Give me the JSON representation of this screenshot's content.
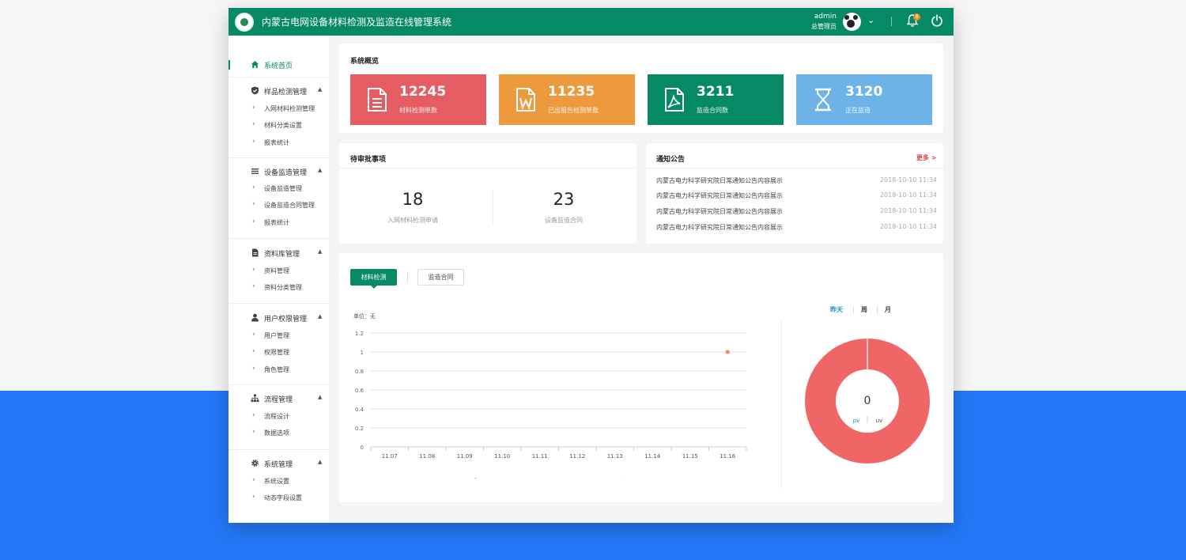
{
  "header": {
    "title": "内蒙古电网设备材料检测及监造在线管理系统",
    "user_name": "admin",
    "user_role": "总管理员",
    "notification_count": "8"
  },
  "sidebar": {
    "home": "系统首页",
    "groups": [
      {
        "label": "样品检测管理",
        "icon": "shield-check-icon",
        "items": [
          "入网材料检测管理",
          "材料分类设置",
          "报表统计"
        ]
      },
      {
        "label": "设备监造管理",
        "icon": "list-icon",
        "items": [
          "设备监造管理",
          "设备监造合同管理",
          "报表统计"
        ]
      },
      {
        "label": "资料库管理",
        "icon": "document-icon",
        "items": [
          "资料管理",
          "资料分类管理"
        ]
      },
      {
        "label": "用户权限管理",
        "icon": "user-icon",
        "items": [
          "用户管理",
          "权限管理",
          "角色管理"
        ]
      },
      {
        "label": "流程管理",
        "icon": "sitemap-icon",
        "items": [
          "流程设计",
          "数据选项"
        ]
      },
      {
        "label": "系统管理",
        "icon": "gear-icon",
        "items": [
          "系统设置",
          "动态字段设置"
        ]
      }
    ]
  },
  "overview": {
    "title": "系统概览",
    "cards": [
      {
        "value": "12245",
        "label": "材料检测单数",
        "color": "#e55c63",
        "icon": "document-lines-icon"
      },
      {
        "value": "11235",
        "label": "已出报告检测单数",
        "color": "#ec9a3d",
        "icon": "word-doc-icon"
      },
      {
        "value": "3211",
        "label": "监造合同数",
        "color": "#068a66",
        "icon": "pdf-doc-icon"
      },
      {
        "value": "3120",
        "label": "正在监造",
        "color": "#6db3e8",
        "icon": "hourglass-icon"
      }
    ]
  },
  "pending": {
    "title": "待审批事项",
    "items": [
      {
        "value": "18",
        "label": "入网材料检测申请"
      },
      {
        "value": "23",
        "label": "设备监造合同"
      }
    ]
  },
  "notices": {
    "title": "通知公告",
    "more": "更多 >",
    "items": [
      {
        "text": "内蒙古电力科学研究院日常通知公告内容展示",
        "time": "2018-10-10 11:34"
      },
      {
        "text": "内蒙古电力科学研究院日常通知公告内容展示",
        "time": "2018-10-10 11:34"
      },
      {
        "text": "内蒙古电力科学研究院日常通知公告内容展示",
        "time": "2018-10-10 11:34"
      },
      {
        "text": "内蒙古电力科学研究院日常通知公告内容展示",
        "time": "2018-10-10 11:34"
      }
    ]
  },
  "tabs": [
    "材料检测",
    "监造合同"
  ],
  "range_tabs": [
    "昨天",
    "周",
    "月"
  ],
  "chart_data": [
    {
      "type": "line",
      "unit_label": "单位：无",
      "categories": [
        "11.07",
        "11.08",
        "11.09",
        "11.10",
        "11.11",
        "11.12",
        "11.13",
        "11.14",
        "11.15",
        "11.16"
      ],
      "y_ticks": [
        "1.2",
        "1",
        "0.8",
        "0.6",
        "0.4",
        "0.2",
        "0"
      ],
      "ylim": [
        0,
        1.2
      ],
      "series": [
        {
          "name": "PV",
          "color": "#5fc2c0",
          "values": [
            null,
            null,
            null,
            null,
            null,
            null,
            null,
            null,
            null,
            null
          ]
        },
        {
          "name": "UV",
          "color": "#e8877e",
          "values": [
            null,
            null,
            null,
            null,
            null,
            null,
            null,
            null,
            null,
            1
          ]
        }
      ],
      "legend_position": "bottom"
    },
    {
      "type": "pie",
      "center_value": "0",
      "toggle_labels": [
        "pv",
        "uv"
      ],
      "slices": [
        {
          "value": 100,
          "color": "#f06667"
        }
      ]
    }
  ]
}
